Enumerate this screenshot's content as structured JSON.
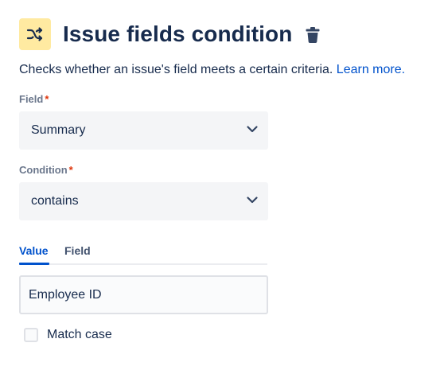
{
  "header": {
    "title": "Issue fields condition",
    "icon": "shuffle-icon",
    "delete_icon": "trash-icon"
  },
  "description": {
    "text": "Checks whether an issue's field meets a certain criteria.",
    "link_label": "Learn more."
  },
  "field": {
    "label": "Field",
    "required_mark": "*",
    "selected": "Summary"
  },
  "condition": {
    "label": "Condition",
    "required_mark": "*",
    "selected": "contains"
  },
  "tabs": {
    "items": [
      {
        "label": "Value",
        "active": true
      },
      {
        "label": "Field",
        "active": false
      }
    ]
  },
  "value_input": {
    "value": "Employee ID"
  },
  "match_case": {
    "label": "Match case",
    "checked": false
  },
  "colors": {
    "icon_bg": "#ffeaa1",
    "link": "#0052cc",
    "required": "#de350b",
    "text": "#172b4d"
  }
}
